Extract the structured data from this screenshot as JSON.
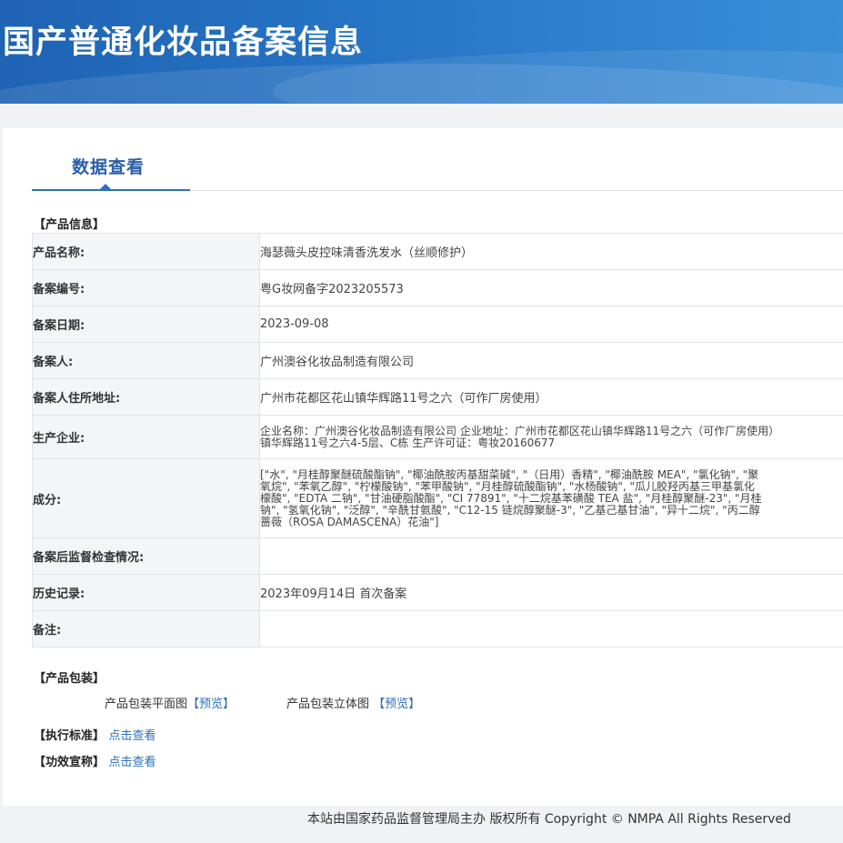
{
  "header": {
    "title": "国产普通化妆品备案信息"
  },
  "tabs": {
    "active_label": "数据查看"
  },
  "product_info": {
    "section_title": "【产品信息】",
    "rows": {
      "name": {
        "label": "产品名称:",
        "value": "海瑟薇头皮控味清香洗发水（丝顺修护）"
      },
      "record_no": {
        "label": "备案编号:",
        "value": "粤G妆网备字2023205573"
      },
      "record_date": {
        "label": "备案日期:",
        "value": "2023-09-08"
      },
      "registrant": {
        "label": "备案人:",
        "value": "广州澳谷化妆品制造有限公司"
      },
      "registrant_address": {
        "label": "备案人住所地址:",
        "value": "广州市花都区花山镇华辉路11号之六（可作厂房使用）"
      },
      "manufacturer": {
        "label": "生产企业:",
        "lines": [
          "企业名称：广州澳谷化妆品制造有限公司 企业地址：广州市花都区花山镇华辉路11号之六（可作厂房使用）",
          "镇华辉路11号之六4-5层、C栋 生产许可证：粤妆20160677"
        ]
      },
      "ingredients": {
        "label": "成分:",
        "lines": [
          "[\"水\", \"月桂醇聚醚硫酸酯钠\", \"椰油酰胺丙基甜菜碱\", \"（日用）香精\", \"椰油酰胺 MEA\", \"氯化钠\", \"聚",
          "氧烷\", \"苯氧乙醇\", \"柠檬酸钠\", \"苯甲酸钠\", \"月桂醇硫酸酯钠\", \"水杨酸钠\", \"瓜儿胶羟丙基三甲基氯化",
          "檬酸\", \"EDTA 二钠\", \"甘油硬脂酸酯\", \"CI 77891\", \"十二烷基苯磺酸 TEA 盐\", \"月桂醇聚醚-23\", \"月桂",
          "钠\", \"氢氧化钠\", \"泛醇\", \"辛酰甘氨酸\", \"C12-15 链烷醇聚醚-3\", \"乙基己基甘油\", \"异十二烷\", \"丙二醇",
          "蔷薇（ROSA DAMASCENA）花油\"]"
        ]
      },
      "post_supervision": {
        "label": "备案后监督检查情况:",
        "value": ""
      },
      "history": {
        "label": "历史记录:",
        "value": "2023年09月14日 首次备案"
      },
      "remarks": {
        "label": "备注:",
        "value": ""
      }
    }
  },
  "packaging": {
    "section_title": "【产品包装】",
    "flat_label": "产品包装平面图",
    "flat_link": "【预览】",
    "solid_label": "产品包装立体图",
    "solid_link": "【预览】"
  },
  "standard": {
    "section_title": "【执行标准】",
    "link": "点击查看"
  },
  "efficacy": {
    "section_title": "【功效宣称】",
    "link": "点击查看"
  },
  "footer": {
    "text": "本站由国家药品监督管理局主办 版权所有 Copyright © NMPA All Rights Reserved"
  }
}
